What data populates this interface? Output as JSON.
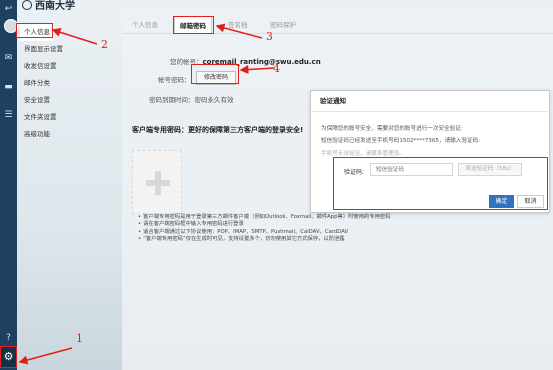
{
  "brand": {
    "name": "西南大学"
  },
  "side_menu": [
    {
      "label": "个人信息",
      "active": true
    },
    {
      "label": "界面显示设置"
    },
    {
      "label": "收发信设置"
    },
    {
      "label": "邮件分类"
    },
    {
      "label": "安全设置"
    },
    {
      "label": "文件夹设置"
    },
    {
      "label": "高级功能"
    }
  ],
  "tabs": [
    {
      "label": "个人信息"
    },
    {
      "label": "邮箱密码",
      "active": true
    },
    {
      "label": "签名档"
    },
    {
      "label": "密码保护"
    }
  ],
  "account": {
    "label": "您的帐号：",
    "value": "coremail_ranting@swu.edu.cn",
    "password_label": "帐号密码：",
    "change_button": "修改密码",
    "expiry_label": "密码到期时间：",
    "expiry_value": "密码永久有效"
  },
  "client_section": {
    "title": "客户端专用密码：更好的保障第三方客户端的登录安全!",
    "notes": [
      "客户端专用密码是用于登录第三方邮件客户端（例如Outlook、Foxmail、邮件App等）时使用的专用密码",
      "请在客户端密码框中输入专用密码进行登录",
      "适合客户端通过以下协议使用：POP、IMAP、SMTP、Pushmail、CalDAV、CardDAV",
      "“客户端专用密码”仅在生成时可见，支持设置多个，切勿使用其它方式保存，以防泄露"
    ]
  },
  "modal": {
    "title": "验证通知",
    "line1": "为保障您的账号安全，需要对您的账号进行一次安全验证:",
    "line2": "短信验证码已经发送至手机号码1502****7365，请输入验证码:",
    "line3": "手机号无法验证，请联系管理员。",
    "code_label": "验证码:",
    "code_placeholder": "短信验证码",
    "send_button": "发送验证码（58s）",
    "ok_button": "确定",
    "cancel_button": "取消"
  },
  "annotations": {
    "n1": "1",
    "n2": "2",
    "n3": "3",
    "n4": "4"
  },
  "colors": {
    "annotation": "#e0201c",
    "primary": "#2f73bf",
    "rail": "#1f4160"
  },
  "icons": [
    "back-arrow-icon",
    "mail-icon",
    "folder-icon",
    "contacts-icon",
    "help-icon",
    "gear-icon"
  ]
}
